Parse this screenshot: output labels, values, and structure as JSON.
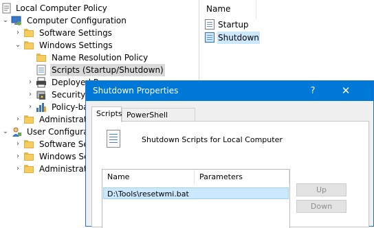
{
  "tree": {
    "root": "Local Computer Policy",
    "computer_config": "Computer Configuration",
    "software_settings": "Software Settings",
    "windows_settings": "Windows Settings",
    "name_resolution": "Name Resolution Policy",
    "scripts": "Scripts (Startup/Shutdown)",
    "deployed": "Deployed Pr",
    "security": "Security S",
    "policy_based": "Policy-ba",
    "admin_templates": "Administrat",
    "user_config": "User Configurati",
    "user_software": "Software Set",
    "user_windows": "Windows Se",
    "user_admin": "Administrati"
  },
  "list": {
    "column_name": "Name",
    "items": [
      "Startup",
      "Shutdown"
    ]
  },
  "dialog": {
    "title": "Shutdown Properties",
    "help_glyph": "?",
    "close_glyph": "✕",
    "tabs": [
      "Scripts",
      "PowerShell Scripts"
    ],
    "caption": "Shutdown Scripts for Local Computer",
    "col_name": "Name",
    "col_params": "Parameters",
    "row": {
      "name": "D:\\Tools\\resetwmi.bat"
    },
    "up_button": "Up",
    "down_button": "Down"
  },
  "colors": {
    "titlebar": "#0078d7",
    "selection": "#cce8ff"
  }
}
